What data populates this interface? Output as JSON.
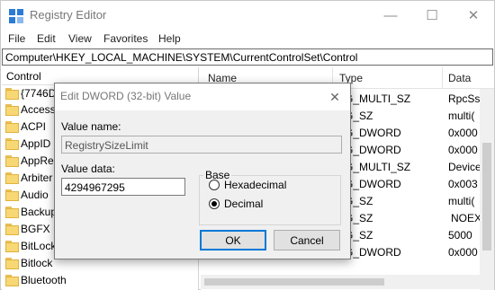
{
  "window": {
    "title": "Registry Editor",
    "controls": {
      "minimize": "—",
      "maximize": "☐",
      "close": "✕"
    }
  },
  "menu": [
    "File",
    "Edit",
    "View",
    "Favorites",
    "Help"
  ],
  "address": "Computer\\HKEY_LOCAL_MACHINE\\SYSTEM\\CurrentControlSet\\Control",
  "tree": {
    "header": "Control",
    "items": [
      "{7746D",
      "Access",
      "ACPI",
      "AppID",
      "AppRe",
      "Arbiter",
      "Audio",
      "Backup",
      "BGFX",
      "BitLock",
      "Bitlock",
      "Bluetooth"
    ]
  },
  "list": {
    "columns": [
      "Name",
      "Type",
      "Data"
    ],
    "rows": [
      {
        "type": "EG_MULTI_SZ",
        "data": "RpcSs"
      },
      {
        "type": "EG_SZ",
        "data": "multi("
      },
      {
        "type": "EG_DWORD",
        "data": "0x000"
      },
      {
        "type": "EG_DWORD",
        "data": "0x000"
      },
      {
        "type": "EG_MULTI_SZ",
        "data": "Device"
      },
      {
        "type": "EG_DWORD",
        "data": "0x003"
      },
      {
        "type": "EG_SZ",
        "data": "multi("
      },
      {
        "type": "EG_SZ",
        "data": "NOEX"
      },
      {
        "type": "EG_SZ",
        "data": "5000"
      },
      {
        "type": "EG_DWORD",
        "data": "0x000"
      }
    ]
  },
  "dialog": {
    "title": "Edit DWORD (32-bit) Value",
    "close": "✕",
    "value_name_label": "Value name:",
    "value_name": "RegistrySizeLimit",
    "value_data_label": "Value data:",
    "value_data": "4294967295",
    "base_label": "Base",
    "hex_label": "Hexadecimal",
    "dec_label": "Decimal",
    "ok": "OK",
    "cancel": "Cancel",
    "selected_base": "Decimal"
  }
}
